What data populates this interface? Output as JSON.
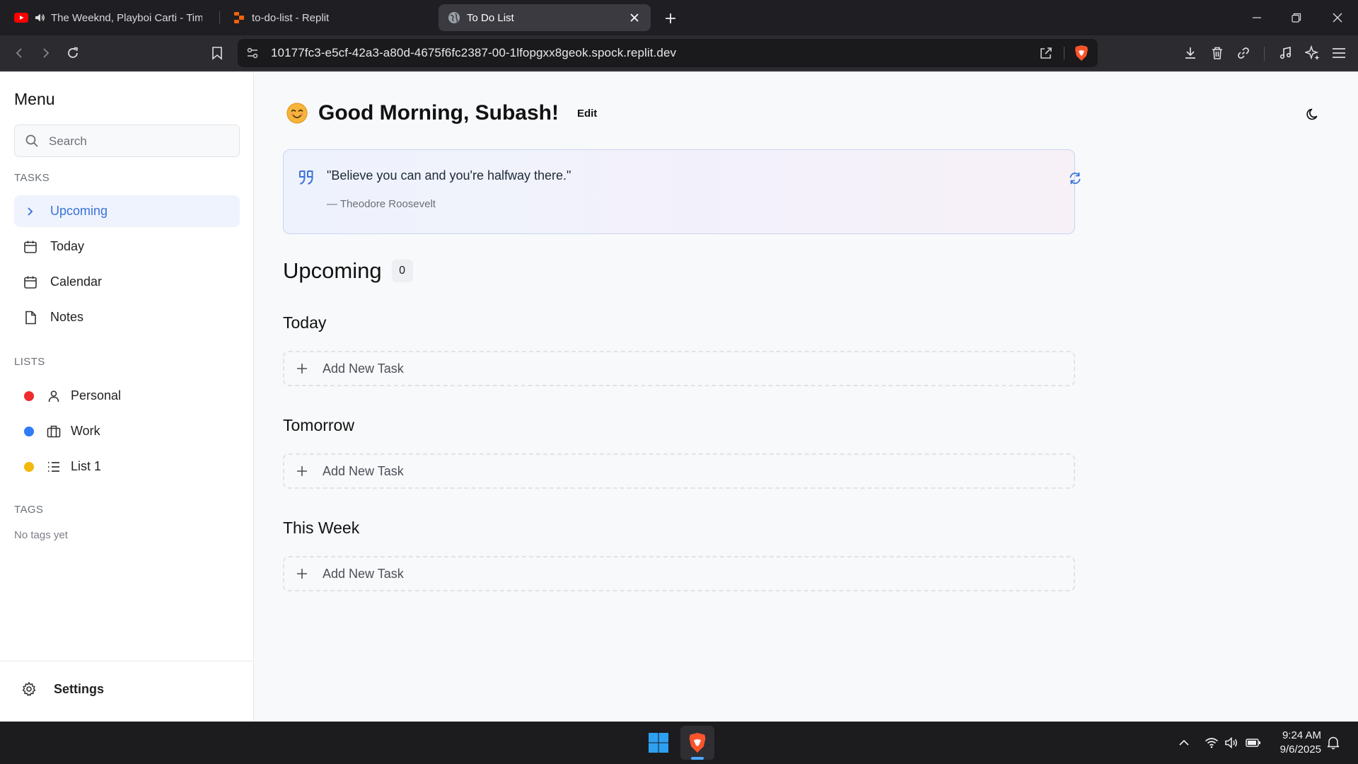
{
  "browser": {
    "tabs": [
      {
        "title": "The Weeknd, Playboi Carti - Timeless",
        "icon": "youtube-icon",
        "audio": true
      },
      {
        "title": "to-do-list - Replit",
        "icon": "replit-icon"
      },
      {
        "title": "To Do List",
        "icon": "globe-icon",
        "active": true
      }
    ],
    "url": "10177fc3-e5cf-42a3-a80d-4675f6fc2387-00-1lfopgxx8geok.spock.replit.dev"
  },
  "sidebar": {
    "title": "Menu",
    "search_placeholder": "Search",
    "tasks_label": "TASKS",
    "tasks": [
      {
        "label": "Upcoming",
        "icon": "chevron-right-icon",
        "active": true
      },
      {
        "label": "Today",
        "icon": "calendar-icon"
      },
      {
        "label": "Calendar",
        "icon": "calendar-icon"
      },
      {
        "label": "Notes",
        "icon": "file-icon"
      }
    ],
    "lists_label": "LISTS",
    "lists": [
      {
        "label": "Personal",
        "color": "#ef2b2b",
        "icon": "user-icon"
      },
      {
        "label": "Work",
        "color": "#2f7cf6",
        "icon": "briefcase-icon"
      },
      {
        "label": "List 1",
        "color": "#f2b90c",
        "icon": "list-icon"
      }
    ],
    "tags_label": "TAGS",
    "tags_empty": "No tags yet",
    "settings_label": "Settings"
  },
  "main": {
    "greeting": "Good Morning, Subash!",
    "edit_label": "Edit",
    "quote": {
      "text": "\"Believe you can and you're halfway there.\"",
      "author": "— Theodore Roosevelt"
    },
    "section_title": "Upcoming",
    "section_count": "0",
    "groups": [
      {
        "title": "Today",
        "add_label": "Add New Task"
      },
      {
        "title": "Tomorrow",
        "add_label": "Add New Task"
      },
      {
        "title": "This Week",
        "add_label": "Add New Task"
      }
    ]
  },
  "taskbar": {
    "time": "9:24 AM",
    "date": "9/6/2025"
  },
  "colors": {
    "accent": "#3a72d8",
    "active_bg": "#eef3fd",
    "brave_orange": "#fb542b"
  }
}
